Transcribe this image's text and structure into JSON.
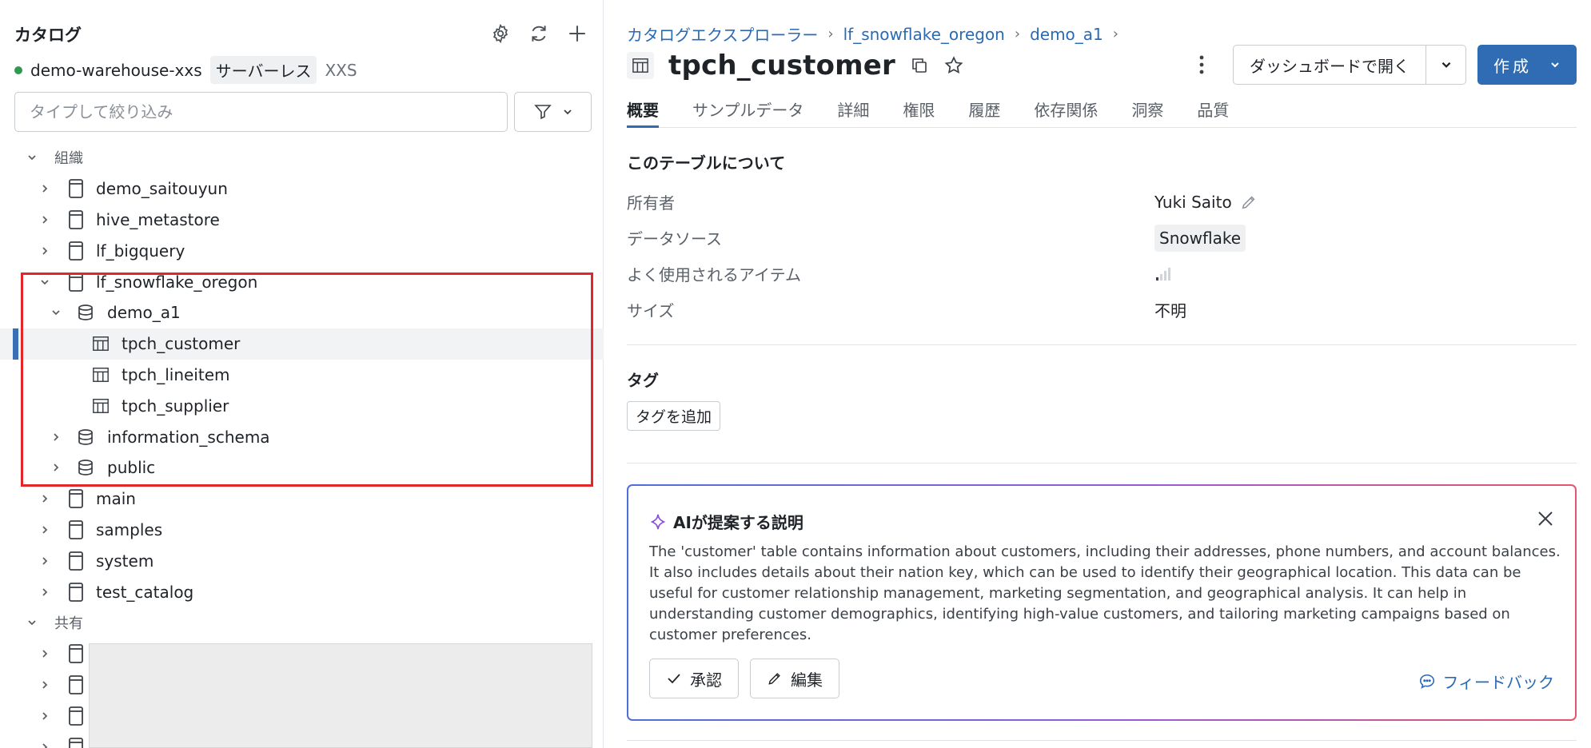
{
  "left_panel": {
    "title": "カタログ",
    "warehouse": {
      "name": "demo-warehouse-xxs",
      "type": "サーバーレス",
      "size": "XXS",
      "status_color": "#2e9a4f"
    },
    "filter": {
      "placeholder": "タイプして絞り込み"
    },
    "sections": {
      "org": "組織",
      "shared": "共有"
    },
    "tree": {
      "demo_saitouyun": "demo_saitouyun",
      "hive_metastore": "hive_metastore",
      "lf_bigquery": "lf_bigquery",
      "lf_snowflake_oregon": "lf_snowflake_oregon",
      "demo_a1": "demo_a1",
      "tpch_customer": "tpch_customer",
      "tpch_lineitem": "tpch_lineitem",
      "tpch_supplier": "tpch_supplier",
      "information_schema": "information_schema",
      "public": "public",
      "main": "main",
      "samples": "samples",
      "system": "system",
      "test_catalog": "test_catalog"
    },
    "highlight_color": "#e3262a",
    "selection_color": "#3a6fb5"
  },
  "right_panel": {
    "breadcrumb": [
      "カタログエクスプローラー",
      "lf_snowflake_oregon",
      "demo_a1"
    ],
    "table_name": "tpch_customer",
    "open_dashboard_label": "ダッシュボードで開く",
    "create_label": "作成",
    "tabs": [
      "概要",
      "サンプルデータ",
      "詳細",
      "権限",
      "履歴",
      "依存関係",
      "洞察",
      "品質"
    ],
    "about": {
      "title": "このテーブルについて",
      "owner_key": "所有者",
      "owner_value": "Yuki Saito",
      "source_key": "データソース",
      "source_value": "Snowflake",
      "frequent_key": "よく使用されるアイテム",
      "size_key": "サイズ",
      "size_value": "不明"
    },
    "tags": {
      "title": "タグ",
      "add_label": "タグを追加"
    },
    "ai": {
      "title": "AIが提案する説明",
      "description": "The 'customer' table contains information about customers, including their addresses, phone numbers, and account balances. It also includes details about their nation key, which can be used to identify their geographical location. This data can be useful for customer relationship management, marketing segmentation, and geographical analysis. It can help in understanding customer demographics, identifying high-value customers, and tailoring marketing campaigns based on customer preferences.",
      "approve_label": "承認",
      "edit_label": "編集",
      "feedback_label": "フィードバック"
    },
    "accent_color": "#2f6cb3"
  }
}
